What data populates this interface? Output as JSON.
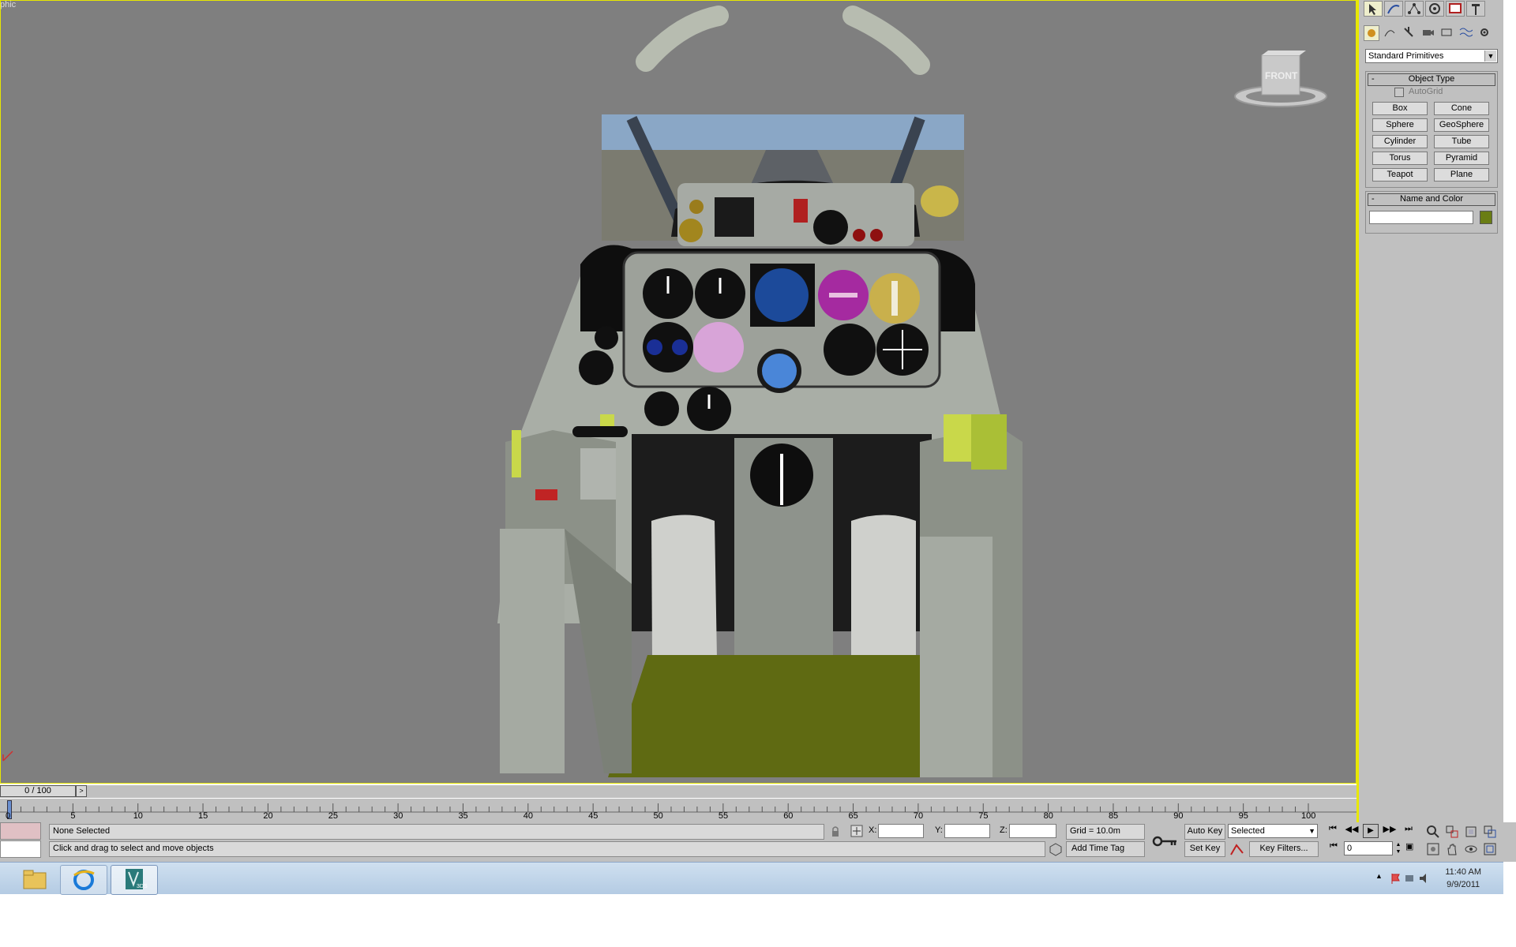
{
  "viewport": {
    "label": "phic",
    "viewcube_label": "FRONT"
  },
  "command_panel": {
    "category_dropdown": "Standard Primitives",
    "object_type": {
      "title": "Object Type",
      "autogrid_label": "AutoGrid",
      "buttons": [
        "Box",
        "Cone",
        "Sphere",
        "GeoSphere",
        "Cylinder",
        "Tube",
        "Torus",
        "Pyramid",
        "Teapot",
        "Plane"
      ]
    },
    "name_and_color": {
      "title": "Name and Color",
      "name_value": "",
      "swatch_color": "#6a7d14"
    }
  },
  "timeline": {
    "slider_label": "0 / 100",
    "ticks": [
      "0",
      "5",
      "10",
      "15",
      "20",
      "25",
      "30",
      "35",
      "40",
      "45",
      "50",
      "55",
      "60",
      "65",
      "70",
      "75",
      "80",
      "85",
      "90",
      "95",
      "100"
    ]
  },
  "status": {
    "selection": "None Selected",
    "prompt": "Click and drag to select and move objects",
    "x_label": "X:",
    "y_label": "Y:",
    "z_label": "Z:",
    "x_value": "",
    "y_value": "",
    "z_value": "",
    "grid": "Grid = 10.0m",
    "add_time_tag": "Add Time Tag",
    "auto_key": "Auto Key",
    "set_key": "Set Key",
    "selected_dropdown": "Selected",
    "key_filters": "Key Filters...",
    "frame_value": "0"
  },
  "taskbar": {
    "time": "11:40 AM",
    "date": "9/9/2011",
    "app_label": "3DS"
  },
  "colors": {
    "viewport_bg": "#7f7f7f",
    "active_border": "#e8e800",
    "cockpit_floor": "#5f6a12",
    "panel_grey": "#a7ada3",
    "accent_yellow_green": "#c9d84a"
  }
}
